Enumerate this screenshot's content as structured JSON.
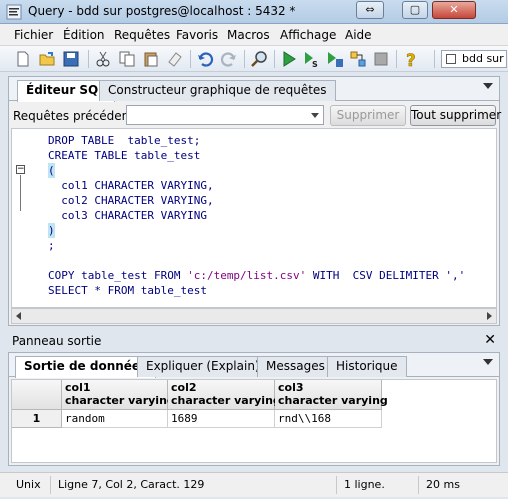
{
  "window": {
    "title": "Query - bdd sur postgres@localhost : 5432 *",
    "restore_glyph": "⇔",
    "maximize_glyph": "▢",
    "close_glyph": "✕"
  },
  "menu": [
    "Fichier",
    "Édition",
    "Requêtes",
    "Favoris",
    "Macros",
    "Affichage",
    "Aide"
  ],
  "toolbar": {
    "icons": [
      "new-file-icon",
      "open-folder-icon",
      "save-icon",
      "cut-icon",
      "copy-icon",
      "paste-icon",
      "clear-icon",
      "undo-icon",
      "redo-icon",
      "find-icon",
      "execute-icon",
      "execute-pgscript-icon",
      "execute-to-file-icon",
      "explain-icon",
      "stop-icon",
      "help-icon"
    ],
    "database": "bdd sur"
  },
  "editor": {
    "tabs": [
      "Éditeur SQL",
      "Constructeur graphique de requêtes"
    ],
    "previous_queries_label": "Requêtes précédentes",
    "delete_button": "Supprimer",
    "delete_all_button": "Tout supprimer",
    "code_lines": [
      "DROP TABLE  table_test;",
      "CREATE TABLE table_test",
      "(",
      "  col1 CHARACTER VARYING,",
      "  col2 CHARACTER VARYING,",
      "  col3 CHARACTER VARYING",
      ")",
      ";",
      "",
      "COPY table_test FROM ",
      "SELECT * FROM table_test"
    ],
    "copy_path": "'c:/temp/list.csv'",
    "copy_rest": " WITH  CSV DELIMITER ','"
  },
  "output": {
    "title": "Panneau sortie",
    "tabs": [
      "Sortie de données",
      "Expliquer (Explain)",
      "Messages",
      "Historique"
    ],
    "columns": [
      {
        "name": "col1",
        "type": "character varying"
      },
      {
        "name": "col2",
        "type": "character varying"
      },
      {
        "name": "col3",
        "type": "character varying"
      }
    ],
    "rows": [
      {
        "index": "1",
        "cells": [
          "random",
          "1689",
          "rnd\\\\168"
        ]
      }
    ]
  },
  "status": {
    "encoding": "Unix",
    "position": "Ligne 7, Col 2, Caract. 129",
    "rows": "1 ligne.",
    "time": "20 ms"
  }
}
